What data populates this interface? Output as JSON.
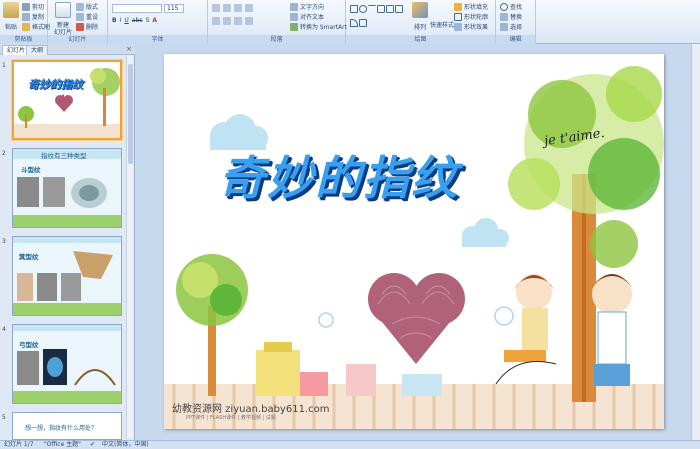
{
  "ribbon": {
    "clipboard": {
      "paste": "粘贴",
      "cut": "剪切",
      "copy": "复制",
      "format_painter": "格式刷",
      "label": "剪贴板"
    },
    "slides": {
      "new_slide": "新建\n幻灯片",
      "layout": "版式",
      "reset": "重设",
      "delete": "删除",
      "label": "幻灯片"
    },
    "font": {
      "font_name": "",
      "font_size": "115",
      "label": "字体"
    },
    "paragraph": {
      "text_direction": "文字方向",
      "align_text": "对齐文本",
      "smartart": "转换为 SmartArt",
      "label": "段落"
    },
    "drawing": {
      "arrange": "排列",
      "quick_styles": "快速样式",
      "shape_fill": "形状填充",
      "shape_outline": "形状轮廓",
      "shape_effects": "形状效果",
      "label": "绘图"
    },
    "editing": {
      "find": "查找",
      "replace": "替换",
      "select": "选择",
      "label": "编辑"
    }
  },
  "pane": {
    "tab_slides": "幻灯片",
    "tab_outline": "大纲",
    "thumbs": [
      {
        "num": "1",
        "title": "奇妙的指纹"
      },
      {
        "num": "2",
        "title": "指纹有三种类型",
        "sub": "斗型纹"
      },
      {
        "num": "3",
        "title": "箕型纹"
      },
      {
        "num": "4",
        "title": "弓型纹"
      },
      {
        "num": "5",
        "title": "想一想，指纹有什么用处？"
      }
    ]
  },
  "slide": {
    "title": "奇妙的指纹",
    "script_text": "je t'aime.",
    "website": "幼教资源网 ziyuan.baby611.com",
    "website_sub": "PPT课件 | FLASH课件 | 教学视频 | 试题"
  },
  "status": {
    "slide_count": "幻灯片 1/7",
    "theme": "\"Office 主题\"",
    "language": "中文(简体，中国)"
  },
  "colors": {
    "title_blue": "#2b7fd6",
    "selection_orange": "#f2a23a",
    "tree_green": "#8cc63f"
  }
}
